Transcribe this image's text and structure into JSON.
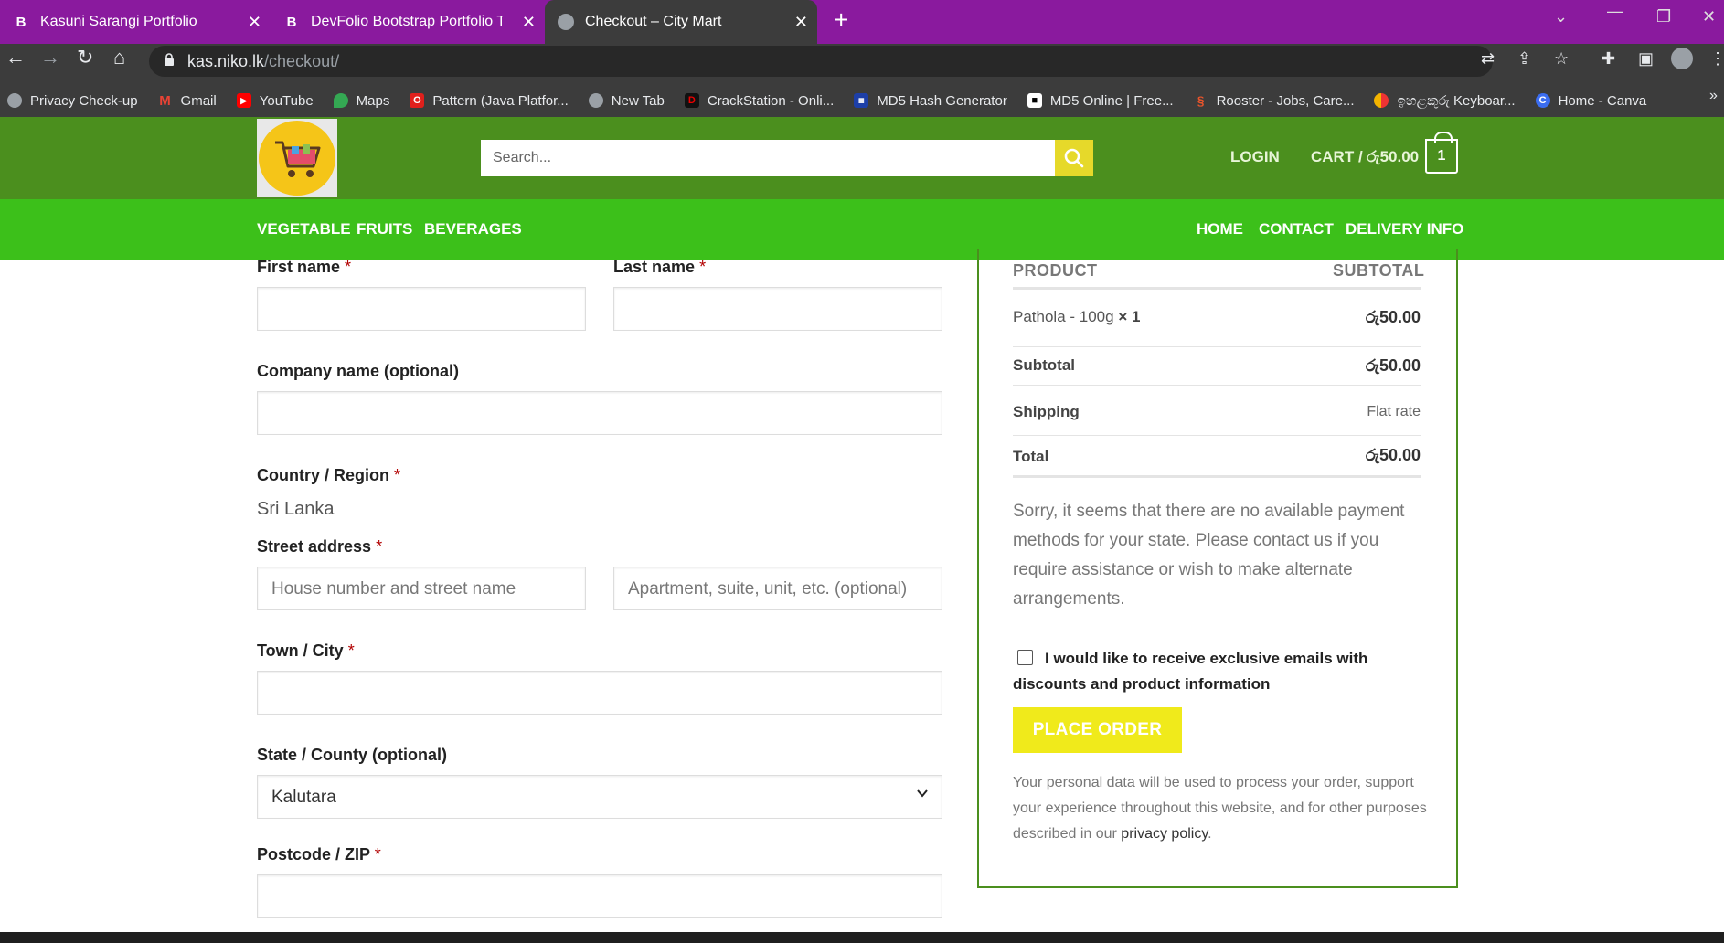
{
  "browser": {
    "tabs": [
      {
        "favicon": "B",
        "title": "Kasuni Sarangi Portfolio"
      },
      {
        "favicon": "B",
        "title": "DevFolio Bootstrap Portfolio Tem"
      },
      {
        "favicon": "globe",
        "title": "Checkout – City Mart"
      }
    ],
    "url_host": "kas.niko.lk",
    "url_path": "/checkout/",
    "bookmarks": [
      "Privacy Check-up",
      "Gmail",
      "YouTube",
      "Maps",
      "Pattern (Java Platfor...",
      "New Tab",
      "CrackStation - Onli...",
      "MD5 Hash Generator",
      "MD5 Online | Free...",
      "Rooster - Jobs, Care...",
      "ඉහළකුරු Keyboar...",
      "Home - Canva"
    ],
    "more_bookmarks": "»"
  },
  "header": {
    "search_placeholder": "Search...",
    "login": "LOGIN",
    "cart_label": "CART / රු50.00",
    "cart_count": "1",
    "categories": [
      "VEGETABLE",
      "FRUITS",
      "BEVERAGES"
    ],
    "menu": [
      "HOME",
      "CONTACT",
      "DELIVERY INFO"
    ]
  },
  "form": {
    "first_name": "First name",
    "last_name": "Last name",
    "company": "Company name (optional)",
    "country_label": "Country / Region",
    "country_value": "Sri Lanka",
    "street_label": "Street address",
    "street_placeholder_1": "House number and street name",
    "street_placeholder_2": "Apartment, suite, unit, etc. (optional)",
    "town": "Town / City",
    "state": "State / County (optional)",
    "state_value": "Kalutara",
    "postcode": "Postcode / ZIP",
    "required_mark": "*"
  },
  "summary": {
    "col_product": "PRODUCT",
    "col_subtotal": "SUBTOTAL",
    "item_name": "Pathola - 100g",
    "item_qty": "× 1",
    "item_price": "රු50.00",
    "subtotal_label": "Subtotal",
    "subtotal_value": "රු50.00",
    "shipping_label": "Shipping",
    "shipping_value": "Flat rate",
    "total_label": "Total",
    "total_value": "රු50.00",
    "notice": "Sorry, it seems that there are no available payment methods for your state. Please contact us if you require assistance or wish to make alternate arrangements.",
    "optin": "I would like to receive exclusive emails with discounts and product information",
    "place_order": "PLACE ORDER",
    "privacy_text": "Your personal data will be used to process your order, support your experience throughout this website, and for other purposes described in our",
    "privacy_link": "privacy policy",
    "privacy_end": "."
  },
  "colors": {
    "tabbar": "#8a1a9e",
    "header_green": "#4b8f1e",
    "nav_green": "#3cc01a",
    "button_yellow": "#f0ea1b"
  }
}
